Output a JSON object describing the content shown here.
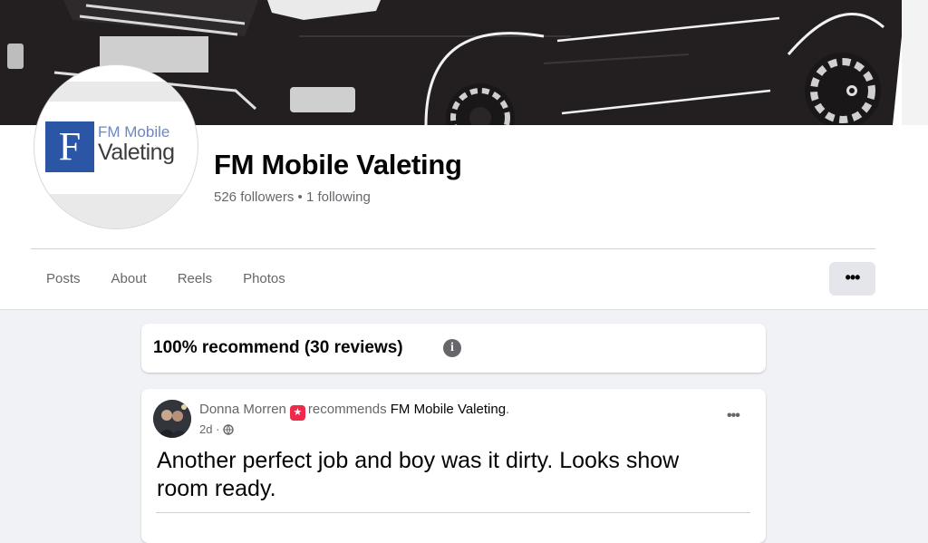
{
  "page": {
    "name": "FM Mobile Valeting",
    "stats": "526 followers • 1 following",
    "logo": {
      "line1": "FM Mobile",
      "line2": "Valeting",
      "initial": "F"
    }
  },
  "tabs": [
    {
      "label": "Posts"
    },
    {
      "label": "About"
    },
    {
      "label": "Reels"
    },
    {
      "label": "Photos"
    }
  ],
  "more_label": "•••",
  "recommend": {
    "title": "100% recommend (30 reviews)",
    "info_icon": "i"
  },
  "post": {
    "author": "Donna Morren",
    "verb": "recommends",
    "target": "FM Mobile Valeting",
    "punct": ".",
    "time": "2d",
    "meta_sep": "·",
    "text": "Another perfect job and boy was it dirty. Looks show room ready.",
    "more_label": "•••"
  },
  "colors": {
    "accent": "#1877f2",
    "logo_blue": "#2a56a5",
    "recommend_badge": "#f02849",
    "tab_text": "#65676b"
  },
  "icons": {
    "more": "more-horizontal-icon",
    "info": "info-icon",
    "privacy": "globe-icon",
    "badge": "recommend-star-icon"
  }
}
